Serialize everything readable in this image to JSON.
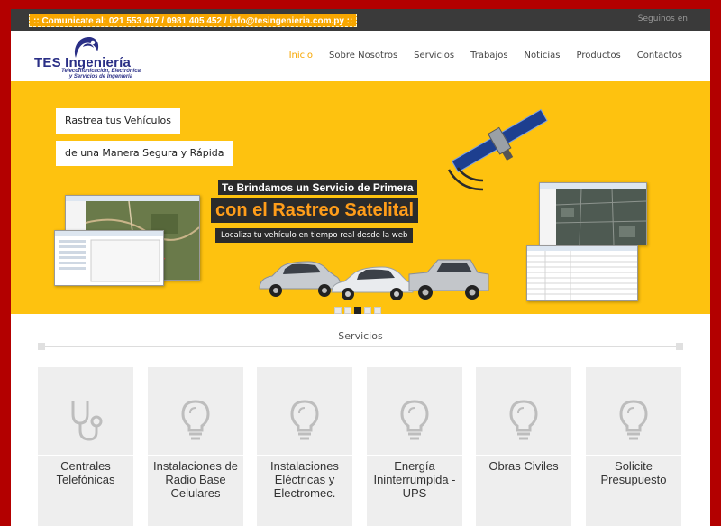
{
  "topbar": {
    "contact": ":: Comunicate al: 021 553 407 / 0981 405 452 / info@tesingenieria.com.py ::",
    "follow": "Seguinos en:"
  },
  "logo": {
    "title_part1": "TES",
    "title_part2": "Ingeniería",
    "subtitle_line1": "Telecomunicación, Electrónica",
    "subtitle_line2": "y Servicios de Ingeniería"
  },
  "nav": {
    "items": [
      "Inicio",
      "Sobre Nosotros",
      "Servicios",
      "Trabajos",
      "Noticias",
      "Productos",
      "Contactos"
    ],
    "active": "Inicio"
  },
  "hero": {
    "pill1": "Rastrea tus Vehículos",
    "pill2": "de una Manera Segura y Rápida",
    "line1": "Te Brindamos un Servicio de Primera",
    "line2": "con el Rastreo Satelital",
    "line3": "Localiza tu vehículo en tiempo real desde la web",
    "slides_total": 5,
    "active_slide": 3,
    "bg_color": "#fec20f"
  },
  "services": {
    "title": "Servicios",
    "cards": [
      {
        "label": "Centrales Telefónicas",
        "icon": "stethoscope-icon"
      },
      {
        "label": "Instalaciones de Radio Base Celulares",
        "icon": "lightbulb-icon"
      },
      {
        "label": "Instalaciones Eléctricas y Electromec.",
        "icon": "lightbulb-icon"
      },
      {
        "label": "Energía Ininterrumpida - UPS",
        "icon": "lightbulb-icon"
      },
      {
        "label": "Obras Civiles",
        "icon": "lightbulb-icon"
      },
      {
        "label": "Solicite Presupuesto",
        "icon": "lightbulb-icon"
      }
    ]
  },
  "colors": {
    "accent": "#f7a600",
    "border": "#b30000",
    "topbar": "#3a3a3a",
    "logo_blue": "#2a2f86"
  }
}
